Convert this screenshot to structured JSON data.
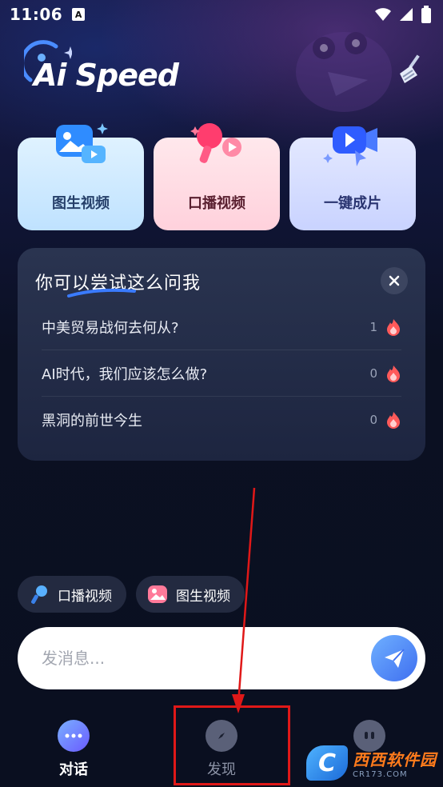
{
  "status_bar": {
    "time": "11:06",
    "a_badge": "A"
  },
  "header": {
    "logo_text": "Ai Speed",
    "clear_icon": "broom-icon"
  },
  "features": [
    {
      "label": "图生视频",
      "icon": "image-video-icon"
    },
    {
      "label": "口播视频",
      "icon": "microphone-video-icon"
    },
    {
      "label": "一键成片",
      "icon": "one-click-video-icon"
    }
  ],
  "suggestions": {
    "title": "你可以尝试这么问我",
    "items": [
      {
        "text": "中美贸易战何去何从?",
        "count": "1"
      },
      {
        "text": "AI时代，我们应该怎么做?",
        "count": "0"
      },
      {
        "text": "黑洞的前世今生",
        "count": "0"
      }
    ]
  },
  "chips": [
    {
      "label": "口播视频",
      "icon": "microphone-icon"
    },
    {
      "label": "图生视频",
      "icon": "image-icon"
    }
  ],
  "composer": {
    "placeholder": "发消息..."
  },
  "nav": [
    {
      "label": "对话",
      "icon": "chat-bubble-icon",
      "active": true
    },
    {
      "label": "发现",
      "icon": "compass-icon",
      "active": false
    },
    {
      "label": "",
      "icon": "profile-face-icon",
      "active": false
    }
  ],
  "watermark": {
    "logo": "C",
    "main": "西西软件园",
    "sub": "CR173.COM"
  },
  "colors": {
    "accent": "#3f6ff0",
    "annotation_red": "#e01818",
    "fire": "#ff5a5a"
  }
}
